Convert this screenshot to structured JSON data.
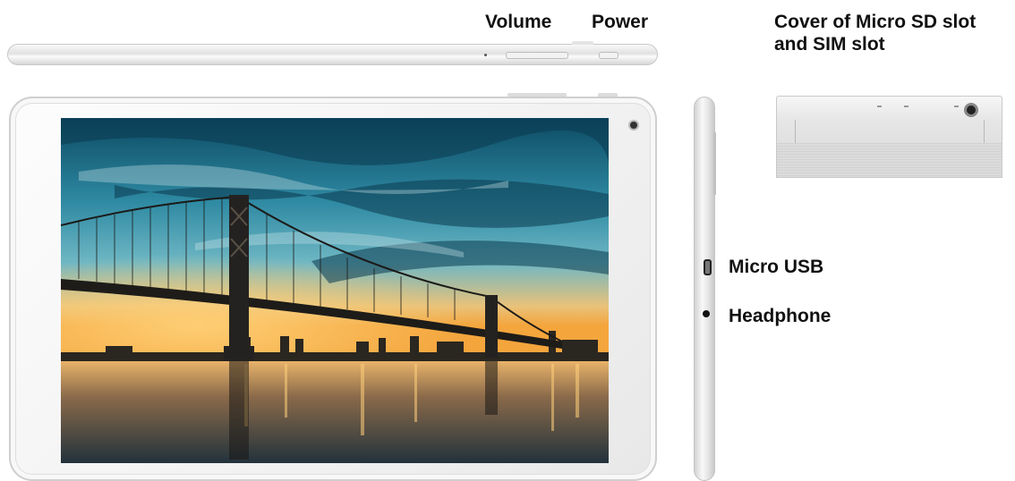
{
  "labels": {
    "volume": "Volume",
    "power": "Power",
    "cover_line1": "Cover of Micro SD slot",
    "cover_line2": "and SIM slot",
    "micro_usb": "Micro USB",
    "headphone": "Headphone"
  },
  "colors": {
    "label_text": "#111111",
    "device_body": "#f2f2f2",
    "device_border": "#cfcfcf",
    "sky_top": "#0f4f66",
    "sunset": "#f4a53c",
    "water": "#2c3e4a"
  },
  "icons": {
    "camera": "front-camera-icon",
    "usb": "micro-usb-port-icon",
    "headphone": "headphone-jack-icon"
  }
}
